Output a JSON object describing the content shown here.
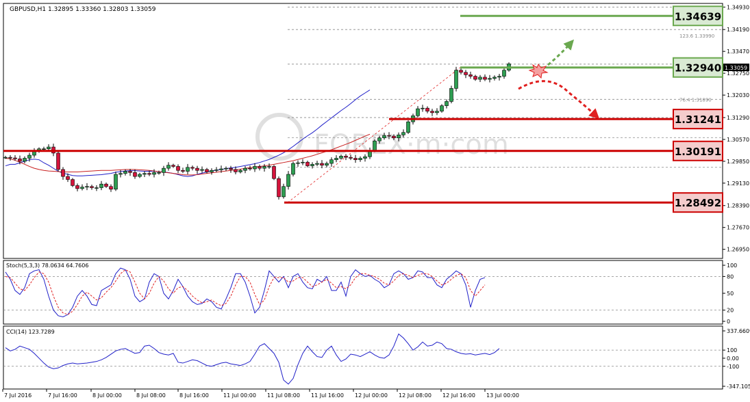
{
  "chart_data": [
    {
      "type": "candlestick",
      "title": "GBPUSD,H1  1.32895 1.33360 1.32803 1.33059",
      "symbol": "GBPUSD,H1",
      "last_price": 1.33059,
      "ylim": [
        1.2665,
        1.3505
      ],
      "y_ticks": [
        "1.34930",
        "1.34190",
        "1.33470",
        "1.32750",
        "1.32030",
        "1.31290",
        "1.30570",
        "1.29850",
        "1.29130",
        "1.28390",
        "1.27670",
        "1.26950"
      ],
      "x_ticks": [
        "7 Jul 2016",
        "7 Jul 16:00",
        "8 Jul 00:00",
        "8 Jul 08:00",
        "8 Jul 16:00",
        "11 Jul 00:00",
        "11 Jul 08:00",
        "11 Jul 16:00",
        "12 Jul 00:00",
        "12 Jul 08:00",
        "12 Jul 16:00",
        "13 Jul 00:00"
      ],
      "candles_close": [
        1.2998,
        1.2996,
        1.2993,
        1.2985,
        1.2995,
        1.3005,
        1.3018,
        1.3026,
        1.3026,
        1.3032,
        1.3012,
        1.2958,
        1.2935,
        1.2925,
        1.2905,
        1.2895,
        1.29,
        1.2902,
        1.2898,
        1.2898,
        1.291,
        1.2902,
        1.2893,
        1.2942,
        1.2945,
        1.2952,
        1.2948,
        1.2935,
        1.2942,
        1.2945,
        1.2942,
        1.2948,
        1.2948,
        1.2962,
        1.2972,
        1.2968,
        1.2955,
        1.2952,
        1.2965,
        1.2962,
        1.2955,
        1.2958,
        1.295,
        1.2955,
        1.2957,
        1.296,
        1.2962,
        1.2958,
        1.295,
        1.2955,
        1.2962,
        1.296,
        1.2968,
        1.2962,
        1.2968,
        1.2968,
        1.2928,
        1.2868,
        1.2902,
        1.2942,
        1.2978,
        1.298,
        1.2982,
        1.297,
        1.2975,
        1.2978,
        1.2972,
        1.2978,
        1.299,
        1.2995,
        1.3002,
        1.2998,
        1.2995,
        1.299,
        1.2995,
        1.3,
        1.302,
        1.3052,
        1.3062,
        1.307,
        1.3068,
        1.3062,
        1.3072,
        1.308,
        1.3115,
        1.3135,
        1.3158,
        1.316,
        1.315,
        1.3145,
        1.315,
        1.3168,
        1.3182,
        1.3225,
        1.3285,
        1.3278,
        1.327,
        1.3265,
        1.3255,
        1.3262,
        1.3255,
        1.3258,
        1.3262,
        1.3265,
        1.3285,
        1.3306
      ],
      "moving_averages": [
        {
          "color": "#1e1ec8",
          "values": [
            1.297,
            1.2975,
            1.2975,
            1.298,
            1.2985,
            1.299,
            1.2992,
            1.299,
            1.298,
            1.2972,
            1.2962,
            1.2952,
            1.2946,
            1.2942,
            1.2938,
            1.2937,
            1.2937,
            1.2938,
            1.2939,
            1.294,
            1.2941,
            1.2943,
            1.2945,
            1.2949,
            1.2951,
            1.2953,
            1.2954,
            1.2954,
            1.2953,
            1.2952,
            1.2952,
            1.2952,
            1.2951,
            1.295,
            1.2948,
            1.2945,
            1.2941,
            1.2937,
            1.2935,
            1.2937,
            1.2942,
            1.2946,
            1.295,
            1.2953,
            1.2956,
            1.2958,
            1.2961,
            1.2963,
            1.2965,
            1.2968,
            1.2971,
            1.2974,
            1.2977,
            1.2981,
            1.2986,
            1.2991,
            1.2998,
            1.3005,
            1.3013,
            1.3023,
            1.3034,
            1.3046,
            1.3058,
            1.3069,
            1.3079,
            1.3091,
            1.3104,
            1.3116,
            1.3128,
            1.314,
            1.3152,
            1.3163,
            1.3175,
            1.3188,
            1.32,
            1.321,
            1.322
          ]
        },
        {
          "color": "#c81e1e",
          "values": [
            1.2995,
            1.2993,
            1.2988,
            1.2982,
            1.2975,
            1.2968,
            1.2962,
            1.2958,
            1.2955,
            1.2953,
            1.2952,
            1.2951,
            1.295,
            1.295,
            1.295,
            1.295,
            1.2951,
            1.2952,
            1.2953,
            1.2954,
            1.2955,
            1.2955,
            1.2955,
            1.2956,
            1.2957,
            1.2958,
            1.2958,
            1.2958,
            1.2957,
            1.2956,
            1.2955,
            1.2953,
            1.2951,
            1.2949,
            1.2947,
            1.2945,
            1.2943,
            1.2941,
            1.294,
            1.294,
            1.2941,
            1.2943,
            1.2945,
            1.2947,
            1.2949,
            1.2951,
            1.2953,
            1.2955,
            1.2957,
            1.2959,
            1.2962,
            1.2964,
            1.2966,
            1.2968,
            1.297,
            1.2972,
            1.2975,
            1.2978,
            1.2981,
            1.2984,
            1.2987,
            1.2991,
            1.2995,
            1.2999,
            1.3003,
            1.3008,
            1.3013,
            1.3018,
            1.3023,
            1.3029,
            1.3035,
            1.3041,
            1.3047,
            1.3054,
            1.3061,
            1.3068,
            1.3074
          ]
        }
      ],
      "horizontal_levels": [
        {
          "value": 1.34639,
          "label": "1.34639",
          "kind": "resistance"
        },
        {
          "value": 1.3294,
          "label": "1.32940",
          "kind": "resistance"
        },
        {
          "value": 1.31241,
          "label": "1.31241",
          "kind": "support"
        },
        {
          "value": 1.30191,
          "label": "1.30191",
          "kind": "support"
        },
        {
          "value": 1.28492,
          "label": "1.28492",
          "kind": "support"
        }
      ],
      "fibonacci_labels": [
        {
          "text": "123.6  1.33990",
          "value": 1.3399
        },
        {
          "text": "76.4  1.31890",
          "value": 1.3189
        }
      ]
    },
    {
      "type": "line",
      "title": "Stoch(5,3,3) 78.0634 64.7606",
      "ylim": [
        0,
        100
      ],
      "y_ticks": [
        "100",
        "80",
        "50",
        "20",
        "0"
      ],
      "series": [
        {
          "color": "#1e1ec8",
          "values": [
            88,
            75,
            55,
            48,
            60,
            85,
            90,
            92,
            75,
            45,
            20,
            10,
            8,
            12,
            25,
            45,
            55,
            45,
            30,
            28,
            55,
            60,
            65,
            85,
            95,
            92,
            75,
            45,
            35,
            40,
            70,
            85,
            80,
            50,
            40,
            55,
            75,
            62,
            45,
            35,
            30,
            32,
            40,
            35,
            25,
            22,
            40,
            60,
            85,
            85,
            70,
            45,
            15,
            25,
            55,
            90,
            80,
            70,
            80,
            60,
            80,
            85,
            70,
            60,
            58,
            75,
            70,
            80,
            55,
            55,
            70,
            45,
            80,
            92,
            85,
            80,
            82,
            75,
            70,
            60,
            65,
            85,
            90,
            85,
            75,
            78,
            90,
            88,
            78,
            78,
            65,
            60,
            75,
            82,
            90,
            85,
            65,
            25,
            55,
            75,
            78
          ]
        },
        {
          "color": "#e02020",
          "style": "dashed",
          "values": [
            80,
            78,
            68,
            58,
            55,
            65,
            78,
            88,
            85,
            70,
            45,
            25,
            15,
            12,
            18,
            30,
            45,
            52,
            45,
            38,
            42,
            52,
            60,
            72,
            85,
            92,
            88,
            70,
            50,
            40,
            50,
            68,
            80,
            72,
            58,
            50,
            60,
            62,
            55,
            45,
            38,
            33,
            35,
            38,
            32,
            28,
            32,
            45,
            65,
            80,
            80,
            70,
            48,
            30,
            38,
            62,
            78,
            78,
            78,
            70,
            72,
            78,
            78,
            70,
            62,
            65,
            70,
            75,
            68,
            60,
            62,
            58,
            65,
            78,
            85,
            85,
            82,
            80,
            75,
            68,
            65,
            72,
            82,
            85,
            82,
            78,
            82,
            85,
            85,
            80,
            72,
            65,
            68,
            75,
            82,
            85,
            78,
            55,
            45,
            55,
            65
          ]
        }
      ]
    },
    {
      "type": "line",
      "title": "CCI(14) 123.7289",
      "ylim": [
        -347.1,
        337.7
      ],
      "y_ticks": [
        "337.6609",
        "100",
        "0.00",
        "-100",
        "-347.105"
      ],
      "series": [
        {
          "color": "#1e1ec8",
          "values": [
            130,
            90,
            110,
            150,
            130,
            110,
            60,
            0,
            -60,
            -110,
            -130,
            -120,
            -90,
            -70,
            -60,
            -70,
            -65,
            -60,
            -50,
            -40,
            -20,
            10,
            50,
            90,
            110,
            120,
            90,
            60,
            70,
            150,
            160,
            120,
            70,
            50,
            40,
            60,
            -50,
            -60,
            -40,
            -20,
            -30,
            -60,
            -90,
            -100,
            -80,
            -60,
            -50,
            -70,
            -80,
            -90,
            -70,
            -40,
            50,
            150,
            180,
            120,
            60,
            -50,
            -270,
            -320,
            -250,
            -80,
            60,
            150,
            80,
            20,
            10,
            100,
            150,
            40,
            -40,
            -10,
            50,
            40,
            20,
            50,
            80,
            40,
            10,
            0,
            40,
            150,
            300,
            250,
            180,
            100,
            140,
            200,
            150,
            160,
            200,
            180,
            120,
            110,
            80,
            60,
            50,
            55,
            40,
            50,
            60,
            45,
            70,
            120
          ]
        }
      ]
    }
  ]
}
